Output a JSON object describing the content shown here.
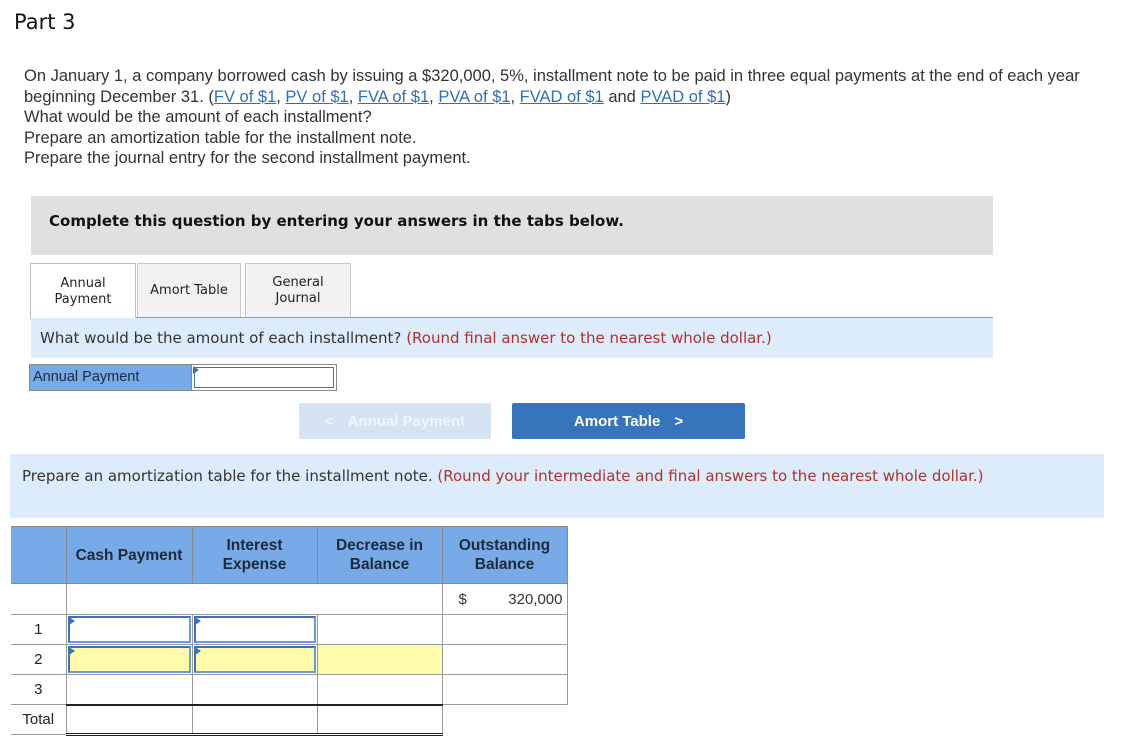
{
  "part_title": "Part 3",
  "intro": {
    "line1": "On January 1, a company borrowed cash by issuing a $320,000, 5%, installment note to be paid in three equal payments at the end of each year beginning December 31. (",
    "links": [
      "FV of $1",
      "PV of $1",
      "FVA of $1",
      "PVA of $1",
      "FVAD of $1",
      "PVAD of $1"
    ],
    "sep_comma": ", ",
    "sep_and": " and ",
    "close_paren": ")",
    "questions": [
      "What would be the amount of each installment?",
      "Prepare an amortization table for the installment note.",
      "Prepare the journal entry for the second installment payment."
    ]
  },
  "instruction_bar": "Complete this question by entering your answers in the tabs below.",
  "tabs": [
    {
      "label_line1": "Annual",
      "label_line2": "Payment",
      "active": true
    },
    {
      "label_line1": "Amort Table",
      "label_line2": "",
      "active": false
    },
    {
      "label_line1": "General",
      "label_line2": "Journal",
      "active": false
    }
  ],
  "annual_payment_section": {
    "question": "What would be the amount of each installment?",
    "hint": "(Round final answer to the nearest whole dollar.)",
    "field_label": "Annual Payment",
    "field_value": ""
  },
  "navigation": {
    "prev_label": "Annual Payment",
    "next_label": "Amort Table",
    "prev_icon": "chevron-left-icon",
    "next_icon": "chevron-right-icon"
  },
  "amort_section": {
    "question": "Prepare an amortization table for the installment note.",
    "hint": "(Round your intermediate and final answers to the nearest whole dollar.)",
    "table": {
      "headers": [
        "",
        "Cash Payment",
        "Interest Expense",
        "Decrease in Balance",
        "Outstanding Balance"
      ],
      "header_lines": [
        [
          "",
          ""
        ],
        [
          "Cash Payment",
          ""
        ],
        [
          "Interest",
          "Expense"
        ],
        [
          "Decrease in",
          "Balance"
        ],
        [
          "Outstanding",
          "Balance"
        ]
      ],
      "opening_balance_currency": "$",
      "opening_balance": "320,000",
      "rows": [
        {
          "label": "1",
          "cash_payment": "",
          "interest_expense": "",
          "decrease": "",
          "balance": ""
        },
        {
          "label": "2",
          "cash_payment": "",
          "interest_expense": "",
          "decrease": "",
          "balance": ""
        },
        {
          "label": "3",
          "cash_payment": "",
          "interest_expense": "",
          "decrease": "",
          "balance": ""
        }
      ],
      "total_label": "Total"
    }
  },
  "colors": {
    "link": "#2f6fb5",
    "hint_red": "#b0312d",
    "header_blue": "#77aae6",
    "question_bg": "#dcecfa",
    "primary_button": "#3674bb",
    "disabled_button": "#d6e3f3",
    "highlight_yellow": "#fffbab"
  }
}
